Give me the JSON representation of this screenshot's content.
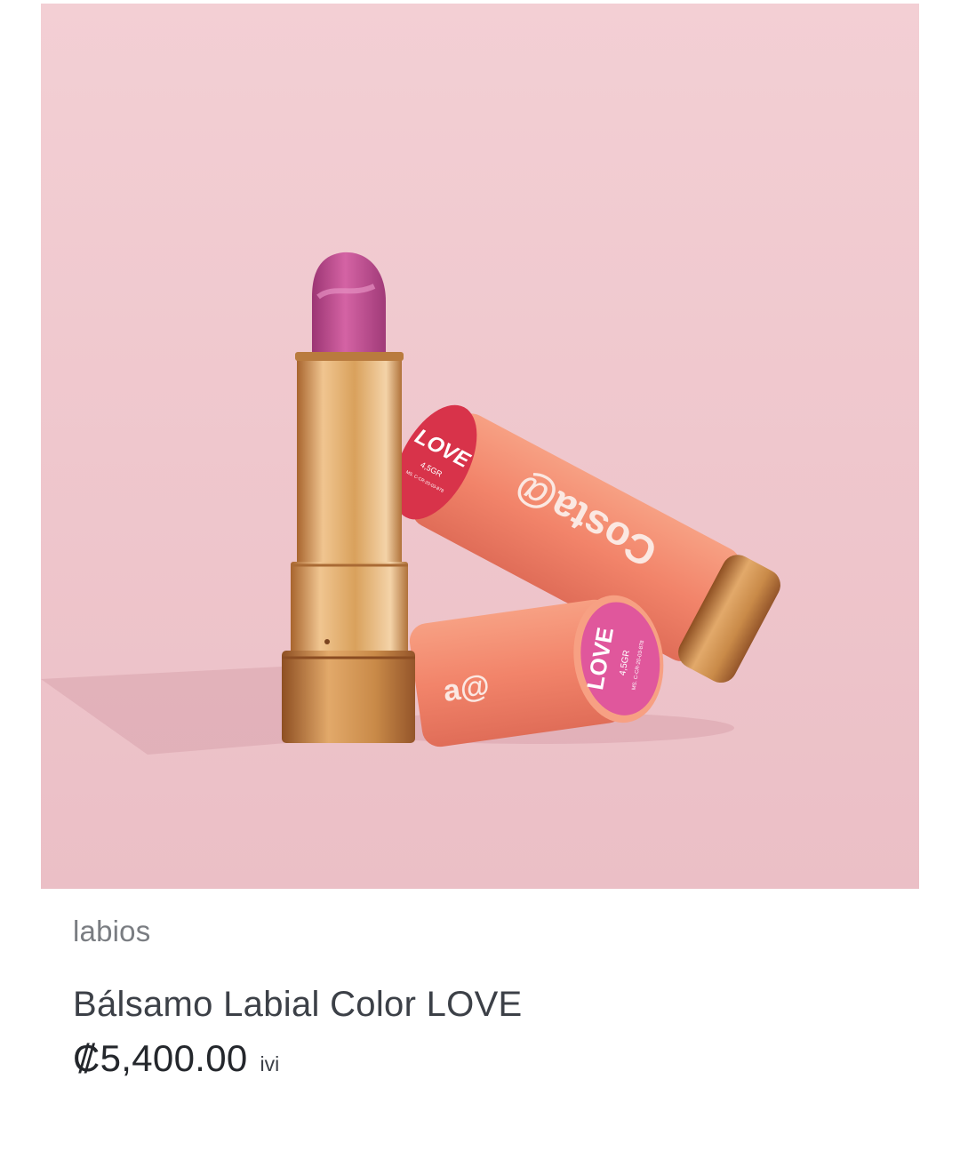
{
  "product": {
    "image_alt": "Bálsamo Labial Color LOVE",
    "image_text": {
      "brand": "Costa@",
      "cap_label": "LOVE",
      "weight": "4,5GR",
      "registry": "MS. C-CR-20-03-878"
    },
    "category": "labios",
    "title": "Bálsamo Labial Color LOVE",
    "price": "₡5,400.00",
    "tax_label": "ivi"
  },
  "colors": {
    "background": "#efc7cd",
    "gold": "#d9a15c",
    "coral": "#f2846a",
    "pink_label": "#e0579c",
    "red_label": "#d8334a",
    "lipstick": "#c0498a"
  }
}
